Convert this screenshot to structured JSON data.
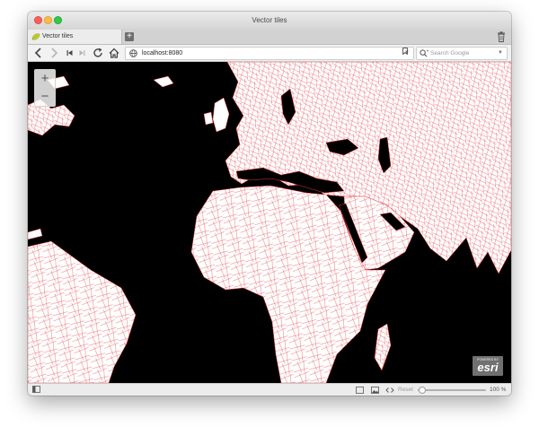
{
  "window": {
    "title": "Vector tiles"
  },
  "tab": {
    "label": "Vector tiles",
    "icon": "leaf-icon"
  },
  "toolbar": {
    "url": "localhost:8080",
    "search_placeholder": "Search Google",
    "icons": [
      "back-icon",
      "forward-icon",
      "first-icon",
      "last-icon",
      "reload-icon",
      "home-icon",
      "globe-icon",
      "bookmark-icon"
    ]
  },
  "map": {
    "zoom_in": "+",
    "zoom_out": "−",
    "attribution_small": "POWERED BY",
    "attribution": "esri",
    "colors": {
      "ocean": "#000000",
      "land": "#ffffff",
      "boundaries": "#e8383d"
    }
  },
  "statusbar": {
    "reset_label": "Reset",
    "zoom_label": "100 %",
    "zoom_value": 0.07
  }
}
